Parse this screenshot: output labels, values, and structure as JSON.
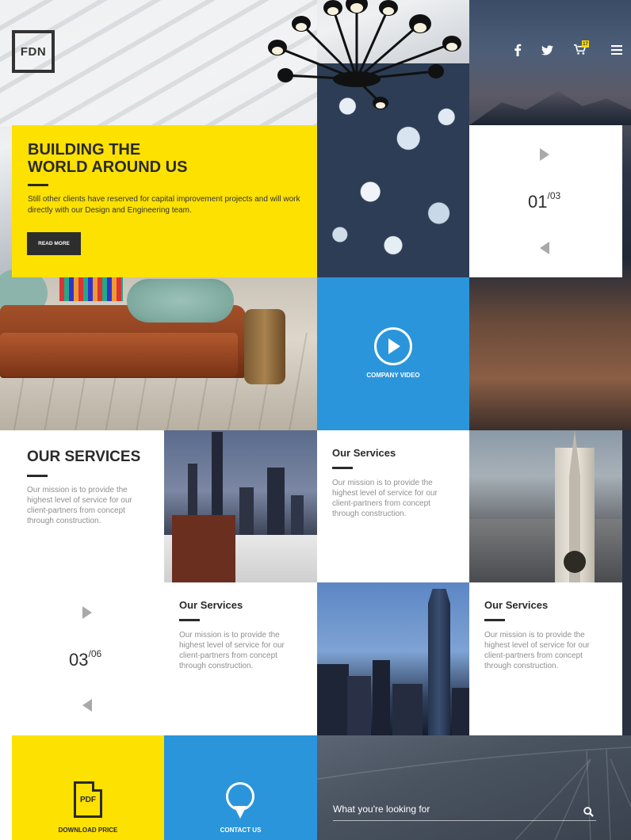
{
  "header": {
    "logo_text": "FDN",
    "cart_count": "17",
    "icons": [
      "facebook-icon",
      "twitter-icon",
      "cart-icon",
      "menu-icon"
    ]
  },
  "hero": {
    "title_line1": "BUILDING THE",
    "title_line2": "WORLD AROUND US",
    "text": "Still other clients have reserved for capital improvement projects and will work directly with our Design and Engineering team.",
    "button_label": "READ MORE"
  },
  "slider": {
    "current": "01",
    "total": "/03"
  },
  "video": {
    "label": "COMPANY VIDEO"
  },
  "services_intro": {
    "title": "OUR SERVICES",
    "text": "Our mission is to provide the highest level of service for our client-partners from concept through construction."
  },
  "service_cards": [
    {
      "title": "Our Services",
      "text": "Our mission is to provide the highest level of service for our client-partners from concept through construction."
    },
    {
      "title": "Our Services",
      "text": "Our mission is to provide the highest level of service for our client-partners from concept through construction."
    },
    {
      "title": "Our Services",
      "text": "Our mission is to provide the highest level of service for our client-partners from concept through construction."
    }
  ],
  "services_slider": {
    "current": "03",
    "total": "/06"
  },
  "bottom": {
    "pdf_icon_text": "PDF",
    "download_label": "DOWNLOAD PRICE",
    "contact_label": "CONTACT US",
    "search_placeholder": "What you're looking for"
  },
  "colors": {
    "yellow": "#fde100",
    "blue": "#2a95db",
    "dark": "#2a2a2a"
  }
}
